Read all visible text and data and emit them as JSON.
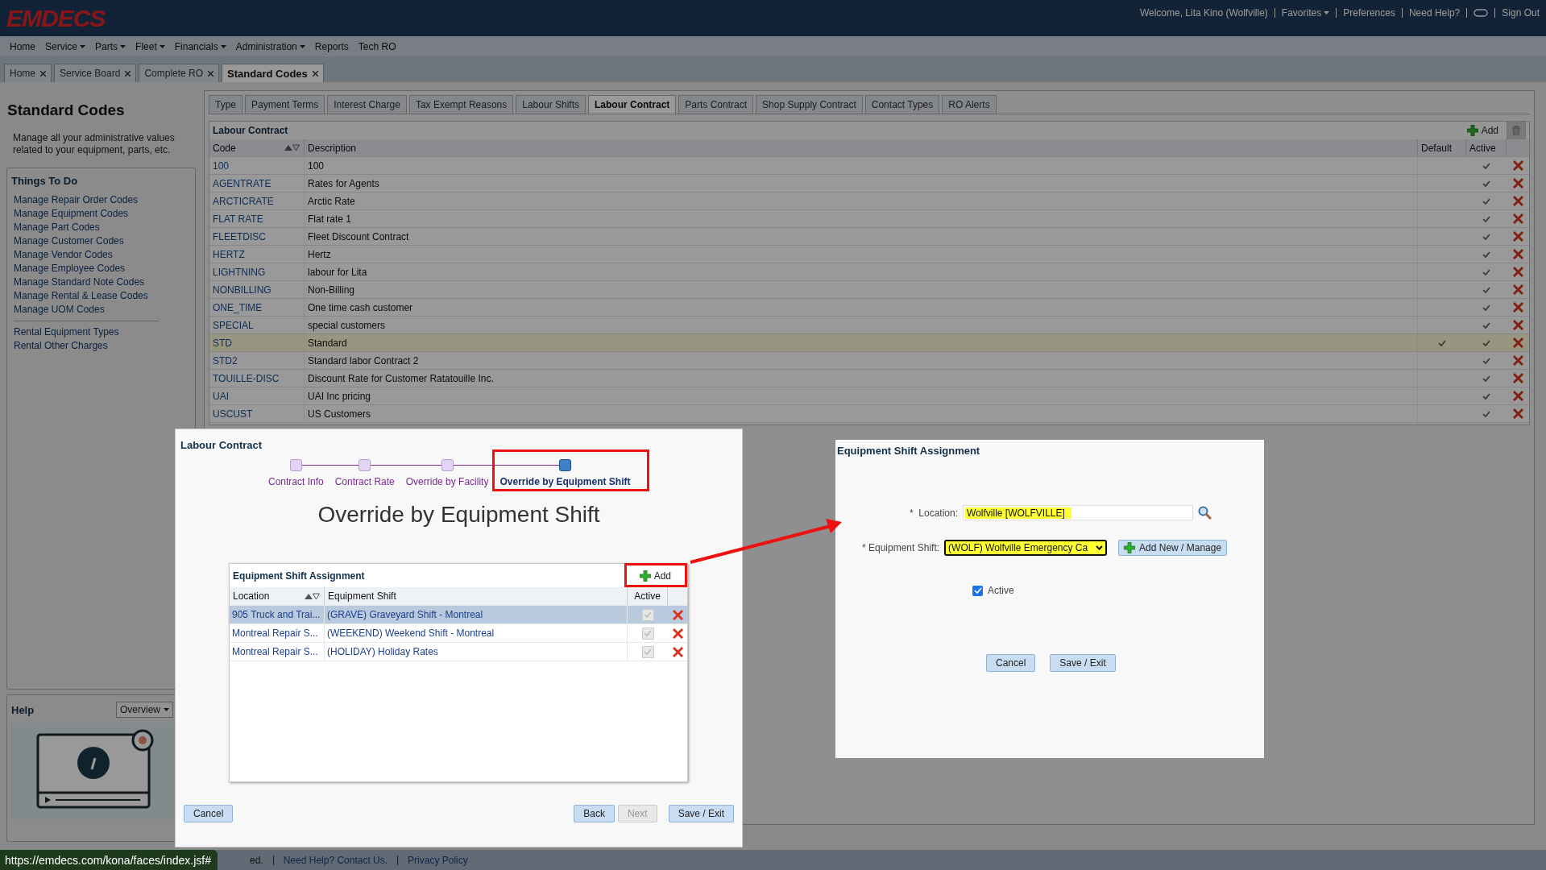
{
  "header": {
    "logo": "EMDECS",
    "welcome": "Welcome, Lita Kino (Wolfville)",
    "links": [
      {
        "label": "Favorites",
        "dropdown": true
      },
      {
        "label": "Preferences",
        "dropdown": false
      },
      {
        "label": "Need Help?",
        "dropdown": false
      }
    ],
    "sign_out": "Sign Out"
  },
  "menu": [
    {
      "label": "Home",
      "dropdown": false
    },
    {
      "label": "Service",
      "dropdown": true
    },
    {
      "label": "Parts",
      "dropdown": true
    },
    {
      "label": "Fleet",
      "dropdown": true
    },
    {
      "label": "Financials",
      "dropdown": true
    },
    {
      "label": "Administration",
      "dropdown": true
    },
    {
      "label": "Reports",
      "dropdown": false
    },
    {
      "label": "Tech RO",
      "dropdown": false
    }
  ],
  "page_tabs": [
    {
      "label": "Home",
      "selected": false
    },
    {
      "label": "Service Board",
      "selected": false
    },
    {
      "label": "Complete RO",
      "selected": false
    },
    {
      "label": "Standard Codes",
      "selected": true
    }
  ],
  "sidebar": {
    "title": "Standard Codes",
    "description": "Manage all your administrative values related to your equipment, parts, etc.",
    "todo_title": "Things To Do",
    "groups": [
      [
        "Manage Repair Order Codes",
        "Manage Equipment Codes",
        "Manage Part Codes",
        "Manage Customer Codes",
        "Manage Vendor Codes",
        "Manage Employee Codes",
        "Manage Standard Note Codes",
        "Manage Rental & Lease Codes",
        "Manage UOM Codes"
      ],
      [
        "Rental Equipment Types",
        "Rental Other Charges"
      ]
    ],
    "help_title": "Help",
    "help_select": "Overview"
  },
  "sub_tabs": [
    {
      "label": "Type",
      "selected": false
    },
    {
      "label": "Payment Terms",
      "selected": false
    },
    {
      "label": "Interest Charge",
      "selected": false
    },
    {
      "label": "Tax Exempt Reasons",
      "selected": false
    },
    {
      "label": "Labour Shifts",
      "selected": false
    },
    {
      "label": "Labour Contract",
      "selected": true
    },
    {
      "label": "Parts Contract",
      "selected": false
    },
    {
      "label": "Shop Supply Contract",
      "selected": false
    },
    {
      "label": "Contact Types",
      "selected": false
    },
    {
      "label": "RO Alerts",
      "selected": false
    }
  ],
  "table": {
    "title": "Labour Contract",
    "add_label": "Add",
    "columns": [
      "Code",
      "Description",
      "Default",
      "Active"
    ],
    "rows": [
      {
        "code": "100",
        "description": "100",
        "default": false,
        "active": true,
        "selected": false
      },
      {
        "code": "AGENTRATE",
        "description": "Rates for Agents",
        "default": false,
        "active": true,
        "selected": false
      },
      {
        "code": "ARCTICRATE",
        "description": "Arctic Rate",
        "default": false,
        "active": true,
        "selected": false
      },
      {
        "code": "FLAT RATE",
        "description": "Flat rate 1",
        "default": false,
        "active": true,
        "selected": false
      },
      {
        "code": "FLEETDISC",
        "description": "Fleet Discount Contract",
        "default": false,
        "active": true,
        "selected": false
      },
      {
        "code": "HERTZ",
        "description": "Hertz",
        "default": false,
        "active": true,
        "selected": false
      },
      {
        "code": "LIGHTNING",
        "description": "labour for Lita",
        "default": false,
        "active": true,
        "selected": false
      },
      {
        "code": "NONBILLING",
        "description": "Non-Billing",
        "default": false,
        "active": true,
        "selected": false
      },
      {
        "code": "ONE_TIME",
        "description": "One time cash customer",
        "default": false,
        "active": true,
        "selected": false
      },
      {
        "code": "SPECIAL",
        "description": "special customers",
        "default": false,
        "active": true,
        "selected": false
      },
      {
        "code": "STD",
        "description": "Standard",
        "default": true,
        "active": true,
        "selected": true
      },
      {
        "code": "STD2",
        "description": "Standard labor Contract 2",
        "default": false,
        "active": true,
        "selected": false
      },
      {
        "code": "TOUILLE-DISC",
        "description": "Discount Rate for Customer Ratatouille Inc.",
        "default": false,
        "active": true,
        "selected": false
      },
      {
        "code": "UAI",
        "description": "UAI Inc pricing",
        "default": false,
        "active": true,
        "selected": false
      },
      {
        "code": "USCUST",
        "description": "US Customers",
        "default": false,
        "active": true,
        "selected": false
      }
    ]
  },
  "wizard": {
    "title": "Labour Contract",
    "steps": [
      {
        "label": "Contract Info",
        "selected": false
      },
      {
        "label": "Contract Rate",
        "selected": false
      },
      {
        "label": "Override by Facility",
        "selected": false
      },
      {
        "label": "Override by Equipment Shift",
        "selected": true
      }
    ],
    "heading": "Override by Equipment Shift",
    "grid": {
      "title": "Equipment Shift Assignment",
      "add_label": "Add",
      "columns": [
        "Location",
        "Equipment Shift",
        "Active"
      ],
      "rows": [
        {
          "location": "905 Truck and Trai...",
          "shift": "(GRAVE) Graveyard Shift - Montreal",
          "active": true,
          "selected": true
        },
        {
          "location": "Montreal Repair S...",
          "shift": "(WEEKEND) Weekend Shift - Montreal",
          "active": true,
          "selected": false
        },
        {
          "location": "Montreal Repair S...",
          "shift": "(HOLIDAY) Holiday Rates",
          "active": true,
          "selected": false
        }
      ]
    },
    "buttons": [
      {
        "label": "Cancel",
        "disabled": false
      },
      {
        "label": "Back",
        "disabled": false
      },
      {
        "label": "Next",
        "disabled": true
      },
      {
        "label": "Save / Exit",
        "disabled": false
      }
    ]
  },
  "assignment": {
    "title": "Equipment Shift Assignment",
    "location_label": "*  Location:",
    "location_value": "Wolfville [WOLFVILLE]",
    "shift_label": "* Equipment Shift:",
    "shift_value": "(WOLF) Wolfville Emergency Ca",
    "add_new_label": "Add New / Manage",
    "active_label": "Active",
    "active": true,
    "buttons": [
      "Cancel",
      "Save / Exit"
    ]
  },
  "footer": {
    "texts": [
      "ed.",
      "Need Help? Contact Us.",
      "Privacy Policy"
    ],
    "url_tooltip": "https://emdecs.com/kona/faces/index.jsf#"
  }
}
